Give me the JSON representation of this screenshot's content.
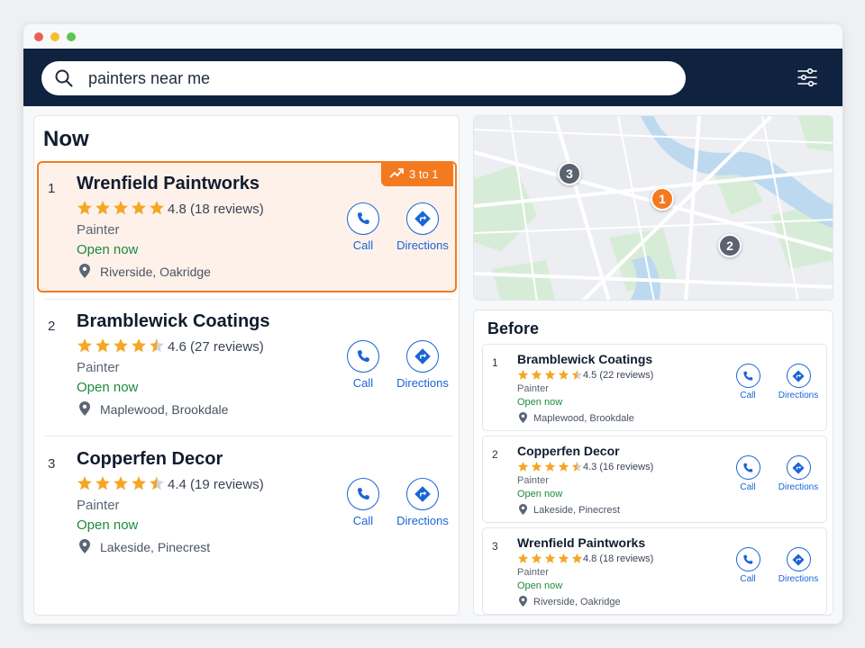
{
  "search": {
    "query": "painters near me"
  },
  "now": {
    "title": "Now",
    "badge": "3 to 1",
    "results": [
      {
        "rank": "1",
        "name": "Wrenfield Paintworks",
        "stars": 4.8,
        "rating_text": "4.8 (18 reviews)",
        "category": "Painter",
        "status": "Open now",
        "location": "Riverside, Oakridge",
        "call_label": "Call",
        "directions_label": "Directions"
      },
      {
        "rank": "2",
        "name": "Bramblewick Coatings",
        "stars": 4.6,
        "rating_text": "4.6 (27 reviews)",
        "category": "Painter",
        "status": "Open now",
        "location": "Maplewood, Brookdale",
        "call_label": "Call",
        "directions_label": "Directions"
      },
      {
        "rank": "3",
        "name": "Copperfen Decor",
        "stars": 4.4,
        "rating_text": "4.4 (19 reviews)",
        "category": "Painter",
        "status": "Open now",
        "location": "Lakeside, Pinecrest",
        "call_label": "Call",
        "directions_label": "Directions"
      }
    ]
  },
  "map": {
    "pins": [
      {
        "label": "1",
        "color": "#f47a20"
      },
      {
        "label": "2",
        "color": "#5b6170"
      },
      {
        "label": "3",
        "color": "#5b6170"
      }
    ]
  },
  "before": {
    "title": "Before",
    "results": [
      {
        "rank": "1",
        "name": "Bramblewick Coatings",
        "stars": 4.5,
        "rating_text": "4.5 (22 reviews)",
        "category": "Painter",
        "status": "Open now",
        "location": "Maplewood, Brookdale",
        "call_label": "Call",
        "directions_label": "Directions"
      },
      {
        "rank": "2",
        "name": "Copperfen Decor",
        "stars": 4.3,
        "rating_text": "4.3 (16 reviews)",
        "category": "Painter",
        "status": "Open now",
        "location": "Lakeside, Pinecrest",
        "call_label": "Call",
        "directions_label": "Directions"
      },
      {
        "rank": "3",
        "name": "Wrenfield Paintworks",
        "stars": 4.8,
        "rating_text": "4.8 (18 reviews)",
        "category": "Painter",
        "status": "Open now",
        "location": "Riverside, Oakridge",
        "call_label": "Call",
        "directions_label": "Directions"
      }
    ]
  },
  "colors": {
    "header_bg": "#0f2240",
    "accent": "#f47a20",
    "link": "#1a64d6",
    "open": "#1e8a3e",
    "star": "#f5a623"
  }
}
